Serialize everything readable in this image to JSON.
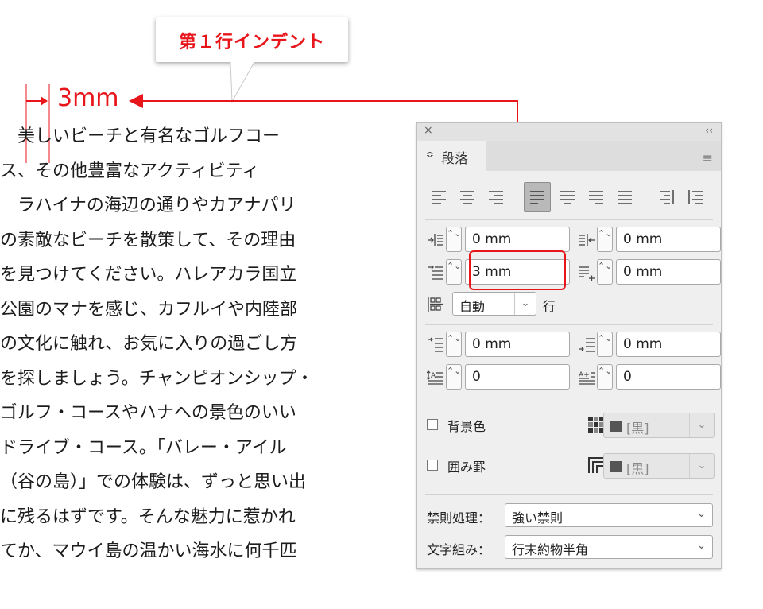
{
  "callout": {
    "label": "第１行インデント"
  },
  "indent_marker": {
    "value": "3mm"
  },
  "article": {
    "lines": [
      "　美しいビーチと有名なゴルフコー",
      "ス、その他豊富なアクティビティ",
      "　ラハイナの海辺の通りやカアナパリ",
      "の素敵なビーチを散策して、その理由",
      "を見つけてください。ハレアカラ国立",
      "公園のマナを感じ、カフルイや内陸部",
      "の文化に触れ、お気に入りの過ごし方",
      "を探しましょう。チャンピオンシップ・",
      "ゴルフ・コースやハナへの景色のいい",
      "ドライブ・コース。「バレー・アイル",
      "（谷の島）」での体験は、ずっと思い出",
      "に残るはずです。そんな魅力に惹かれ",
      "てか、マウイ島の温かい海水に何千匹"
    ]
  },
  "panel": {
    "close_icon": "×",
    "collapse_icon": "‹‹",
    "tab_arrows": "≎",
    "tab_label": "段落",
    "menu_icon": "≡",
    "left_indent": "0 mm",
    "right_indent": "0 mm",
    "first_line_indent": "3 mm",
    "last_line_right_indent": "0 mm",
    "grid_alignment": "自動",
    "grid_chevron": "⌄",
    "grid_unit": "行",
    "space_before": "0 mm",
    "space_after": "0 mm",
    "drop_cap_lines": "0",
    "drop_cap_chars": "0",
    "shading_label": "背景色",
    "shading_color": "[黒]",
    "border_label": "囲み罫",
    "border_color": "[黒]",
    "kinsoku_label": "禁則処理：",
    "kinsoku_value": "強い禁則",
    "mojikumi_label": "文字組み：",
    "mojikumi_value": "行末約物半角",
    "spin_glyph": "⌃⌄",
    "chevron": "⌄"
  },
  "colors": {
    "accent": "#e8151b",
    "panel_bg": "#efefef"
  }
}
